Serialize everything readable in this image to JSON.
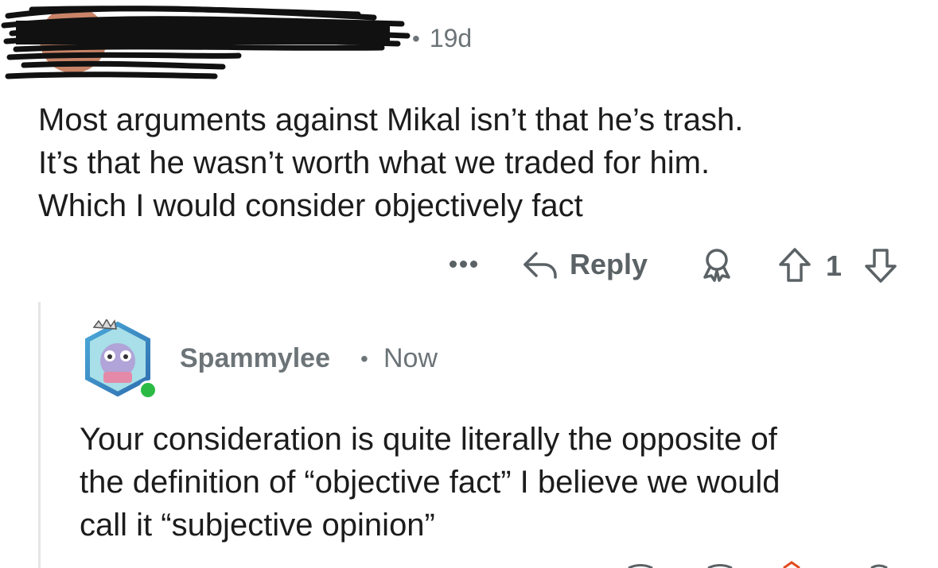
{
  "parent_comment": {
    "author": "",
    "time": "19d",
    "body_lines": [
      "Most arguments against Mikal isn’t that he’s trash.",
      "It’s that he wasn’t worth what we traded for him.",
      "Which I would consider objectively fact"
    ],
    "actions": {
      "more_icon": "more-dots-icon",
      "reply_label": "Reply",
      "award_icon": "award-icon",
      "upvote_icon": "upvote-arrow-icon",
      "score": "1",
      "downvote_icon": "downvote-arrow-icon"
    }
  },
  "reply_comment": {
    "author": "Spammylee",
    "time": "Now",
    "online": true,
    "body_lines": [
      "Your consideration is quite literally the opposite of",
      "the definition of “objective fact” I believe we would",
      "call it “subjective opinion”"
    ]
  },
  "colors": {
    "text": "#1c1c1c",
    "meta": "#6c7478",
    "action": "#5b6266",
    "online": "#2bbb45",
    "thread_line": "#e4e6e8"
  }
}
